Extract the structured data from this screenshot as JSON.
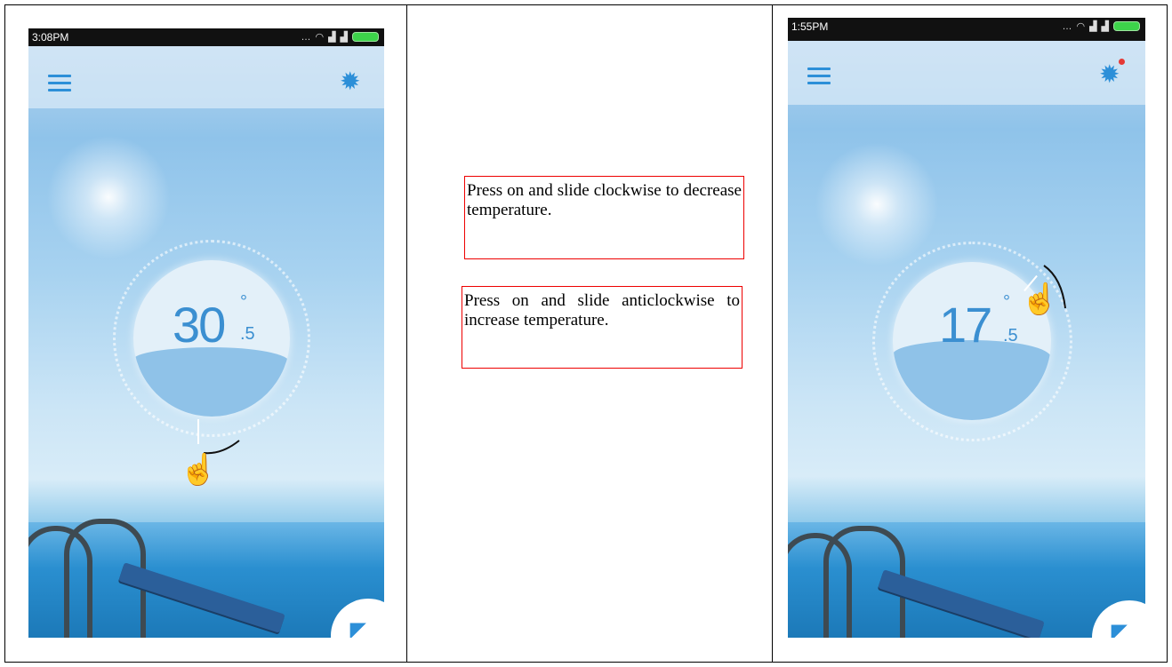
{
  "left_phone": {
    "time": "3:08PM",
    "temp_whole": "30",
    "temp_degree": "°",
    "temp_decimal": ".5",
    "gesture": "tap-hand"
  },
  "right_phone": {
    "time": "1:55PM",
    "temp_whole": "17",
    "temp_degree": "°",
    "temp_decimal": ".5",
    "gesture": "tap-hand",
    "settings_badge": true
  },
  "notes": {
    "clockwise": "Press on and slide clockwise to decrease temperature.",
    "anticlockwise": "Press on and slide anticlockwise to increase temperature."
  },
  "icons": {
    "menu": "hamburger-icon",
    "settings": "gear-icon",
    "corner": "curve-icon"
  },
  "colors": {
    "accent": "#2c8fd8",
    "temp_text": "#3b8fd1",
    "annotation_border": "#e00000"
  }
}
